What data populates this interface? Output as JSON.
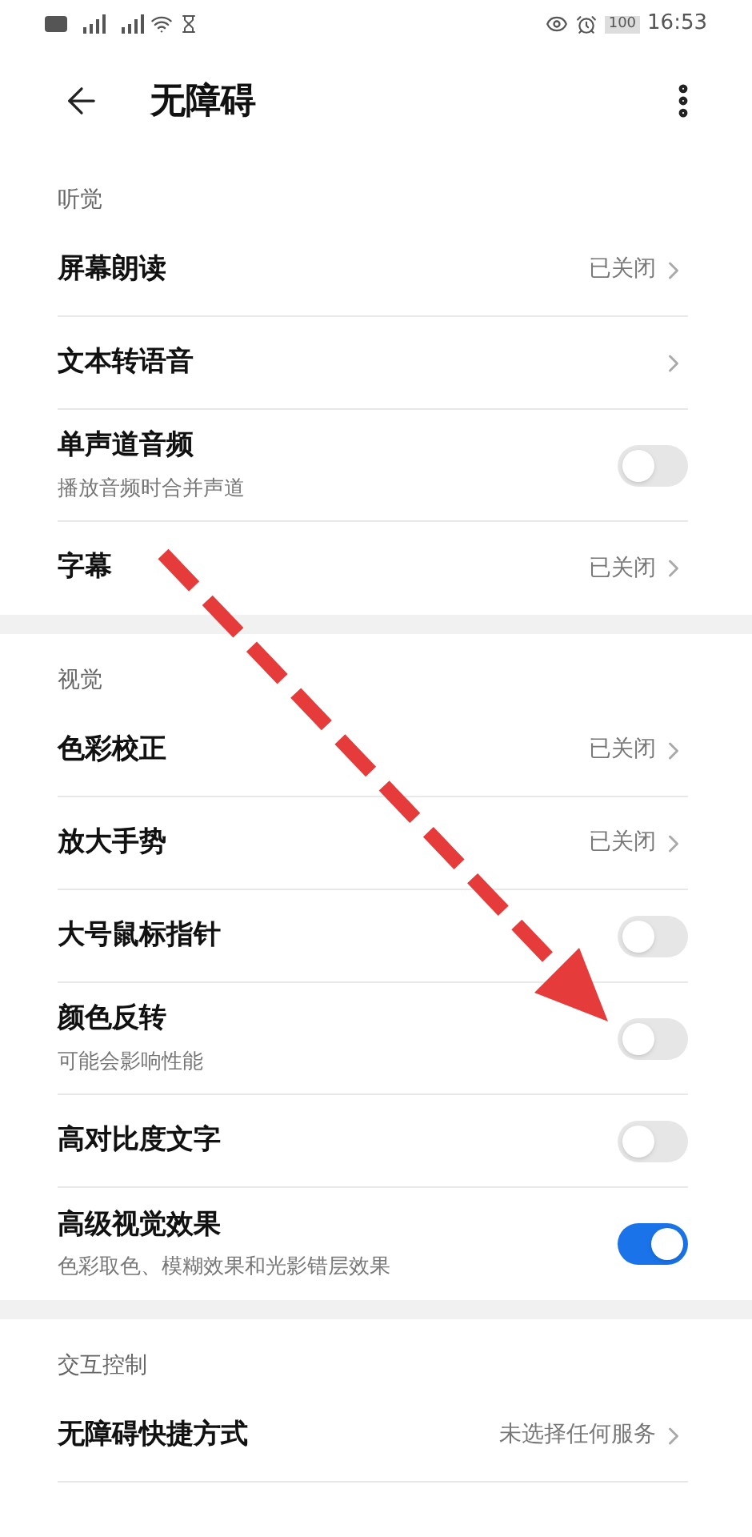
{
  "status_bar": {
    "time": "16:53",
    "battery": "100"
  },
  "header": {
    "title": "无障碍"
  },
  "sections": [
    {
      "title": "听觉",
      "items": [
        {
          "kind": "link",
          "label": "屏幕朗读",
          "value": "已关闭"
        },
        {
          "kind": "link",
          "label": "文本转语音"
        },
        {
          "kind": "toggle",
          "label": "单声道音频",
          "subtitle": "播放音频时合并声道",
          "on": false
        },
        {
          "kind": "link",
          "label": "字幕",
          "value": "已关闭"
        }
      ]
    },
    {
      "title": "视觉",
      "items": [
        {
          "kind": "link",
          "label": "色彩校正",
          "value": "已关闭"
        },
        {
          "kind": "link",
          "label": "放大手势",
          "value": "已关闭"
        },
        {
          "kind": "toggle",
          "label": "大号鼠标指针",
          "on": false
        },
        {
          "kind": "toggle",
          "label": "颜色反转",
          "subtitle": "可能会影响性能",
          "on": false
        },
        {
          "kind": "toggle",
          "label": "高对比度文字",
          "on": false
        },
        {
          "kind": "toggle",
          "label": "高级视觉效果",
          "subtitle": "色彩取色、模糊效果和光影错层效果",
          "on": true
        }
      ]
    },
    {
      "title": "交互控制",
      "items": [
        {
          "kind": "link",
          "label": "无障碍快捷方式",
          "value": "未选择任何服务"
        }
      ]
    }
  ]
}
